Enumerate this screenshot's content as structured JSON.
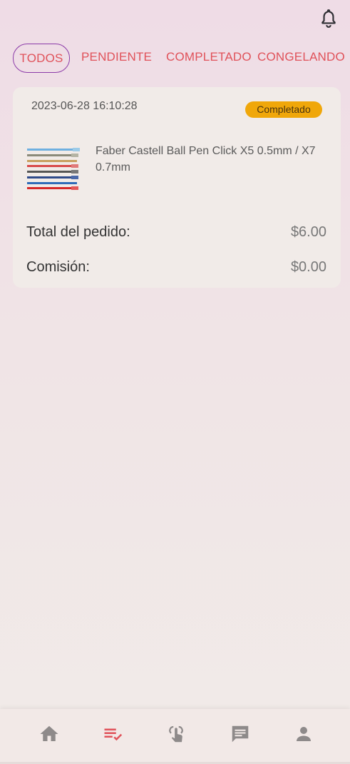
{
  "tabs": [
    {
      "label": "TODOS",
      "active": true
    },
    {
      "label": "PENDIENTE",
      "active": false
    },
    {
      "label": "COMPLETADO",
      "active": false
    },
    {
      "label": "CONGELANDO",
      "active": false
    }
  ],
  "order": {
    "date": "2023-06-28 16:10:28",
    "status": "Completado",
    "product_name": "Faber Castell Ball Pen Click X5 0.5mm / X7 0.7mm",
    "total_label": "Total del pedido:",
    "total_value": "$6.00",
    "commission_label": "Comisión:",
    "commission_value": "$0.00"
  },
  "icons": {
    "top": "bell-icon",
    "nav": [
      "home-icon",
      "orders-icon",
      "tap-icon",
      "messages-icon",
      "profile-icon"
    ]
  },
  "colors": {
    "tab_text": "#e0525a",
    "active_tab_border": "#8b3aa8",
    "status_badge": "#f0a70a",
    "nav_active": "#e0525a",
    "nav_inactive": "#8e8a8a"
  }
}
